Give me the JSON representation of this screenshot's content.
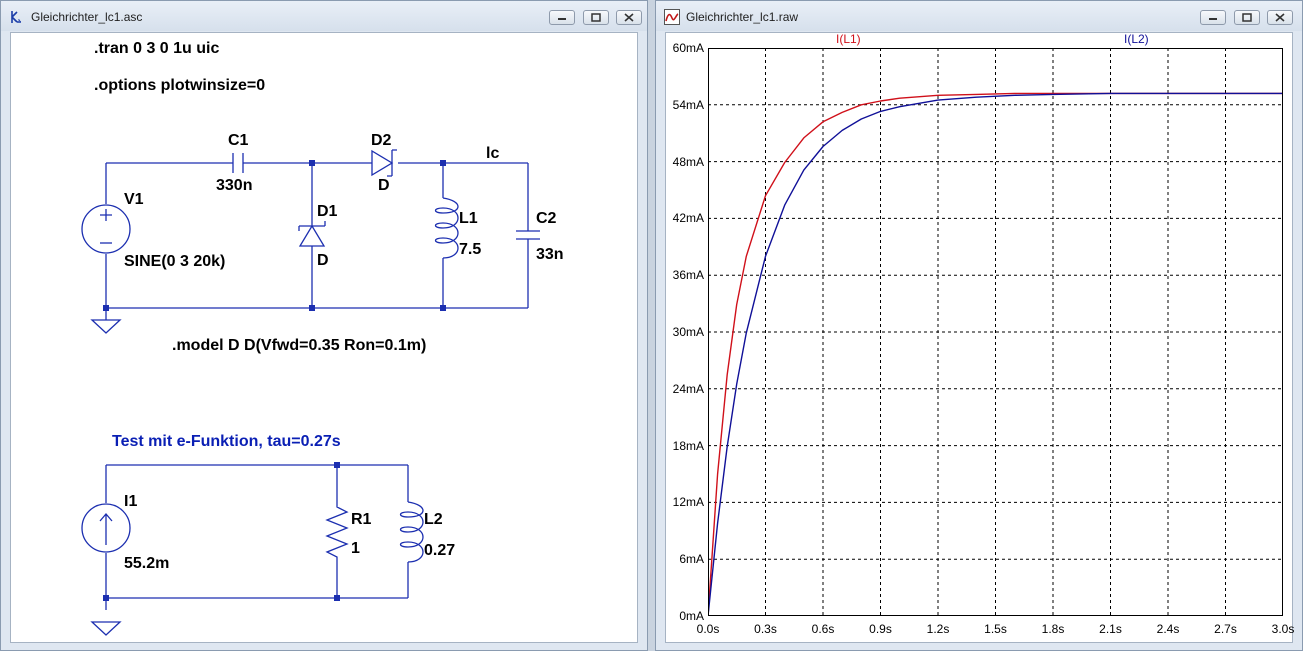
{
  "left_window": {
    "title": "Gleichrichter_lc1.asc",
    "directives": {
      "tran": ".tran 0 3 0 1u uic",
      "options": ".options plotwinsize=0",
      "model": ".model D D(Vfwd=0.35 Ron=0.1m)"
    },
    "components": {
      "c1_name": "C1",
      "c1_value": "330n",
      "d2_name": "D2",
      "d2_value": "D",
      "lc_label": "lc",
      "v1_name": "V1",
      "v1_value": "SINE(0 3 20k)",
      "d1_name": "D1",
      "d1_value": "D",
      "l1_name": "L1",
      "l1_value": "7.5",
      "c2_name": "C2",
      "c2_value": "33n",
      "i1_name": "I1",
      "i1_value": "55.2m",
      "r1_name": "R1",
      "r1_value": "1",
      "l2_name": "L2",
      "l2_value": "0.27"
    },
    "comment": "Test mit e-Funktion, tau=0.27s"
  },
  "right_window": {
    "title": "Gleichrichter_lc1.raw",
    "traces": {
      "l1_label": "I(L1)",
      "l2_label": "I(L2)"
    },
    "y_ticks": [
      "60mA",
      "54mA",
      "48mA",
      "42mA",
      "36mA",
      "30mA",
      "24mA",
      "18mA",
      "12mA",
      "6mA",
      "0mA"
    ],
    "x_ticks": [
      "0.0s",
      "0.3s",
      "0.6s",
      "0.9s",
      "1.2s",
      "1.5s",
      "1.8s",
      "2.1s",
      "2.4s",
      "2.7s",
      "3.0s"
    ]
  },
  "colors": {
    "wire": "#1c2fb0",
    "trace_l1": "#d0101a",
    "trace_l2": "#101098",
    "comment_blue": "#0a1fb4"
  },
  "chart_data": {
    "type": "line",
    "x": [
      0,
      0.05,
      0.1,
      0.15,
      0.2,
      0.3,
      0.4,
      0.5,
      0.6,
      0.7,
      0.8,
      0.9,
      1.0,
      1.2,
      1.4,
      1.6,
      1.8,
      2.1,
      2.4,
      2.7,
      3.0
    ],
    "series": [
      {
        "name": "I(L1)",
        "values": [
          0,
          15.0,
          25.5,
          32.9,
          38.0,
          44.4,
          47.9,
          50.5,
          52.2,
          53.2,
          54.0,
          54.4,
          54.7,
          55.0,
          55.1,
          55.2,
          55.2,
          55.2,
          55.2,
          55.2,
          55.2
        ]
      },
      {
        "name": "I(L2)",
        "values": [
          0,
          9.8,
          17.9,
          24.5,
          29.9,
          38.0,
          43.4,
          47.1,
          49.6,
          51.3,
          52.5,
          53.3,
          53.8,
          54.5,
          54.8,
          55.0,
          55.1,
          55.2,
          55.2,
          55.2,
          55.2
        ]
      }
    ],
    "xlim": [
      0,
      3.0
    ],
    "ylim": [
      0,
      60
    ],
    "xlabel": "",
    "ylabel": "",
    "grid": true
  }
}
